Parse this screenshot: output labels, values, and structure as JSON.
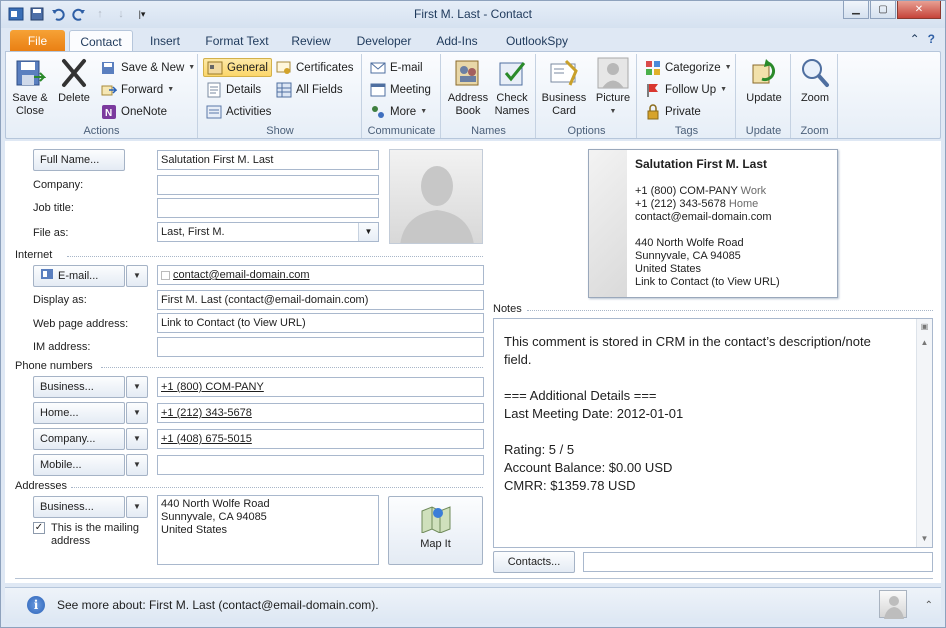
{
  "window": {
    "title": "First M. Last  -  Contact"
  },
  "qat": {
    "icons": [
      "outlook-icon",
      "save-icon",
      "undo-icon",
      "redo-icon",
      "prev-icon",
      "next-icon",
      "customize-icon"
    ]
  },
  "tabs": [
    "File",
    "Contact",
    "Insert",
    "Format Text",
    "Review",
    "Developer",
    "Add-Ins",
    "OutlookSpy"
  ],
  "ribbon": {
    "actions": {
      "save_close": "Save &\nClose",
      "delete": "Delete",
      "save_new": "Save & New",
      "forward": "Forward",
      "onenote": "OneNote",
      "label": "Actions"
    },
    "show": {
      "general": "General",
      "details": "Details",
      "activities": "Activities",
      "certificates": "Certificates",
      "all_fields": "All Fields",
      "label": "Show"
    },
    "communicate": {
      "email": "E-mail",
      "meeting": "Meeting",
      "more": "More",
      "label": "Communicate"
    },
    "names": {
      "address_book": "Address\nBook",
      "check_names": "Check\nNames",
      "label": "Names"
    },
    "options": {
      "business_card": "Business\nCard",
      "picture": "Picture",
      "label": "Options"
    },
    "tags": {
      "categorize": "Categorize",
      "follow_up": "Follow Up",
      "private": "Private",
      "label": "Tags"
    },
    "update": {
      "update": "Update",
      "label": "Update"
    },
    "zoom": {
      "zoom": "Zoom",
      "label": "Zoom"
    }
  },
  "form": {
    "full_name_btn": "Full Name...",
    "full_name": "Salutation First M. Last",
    "company_label": "Company:",
    "company": "",
    "job_title_label": "Job title:",
    "job_title": "",
    "file_as_label": "File as:",
    "file_as": "Last, First M.",
    "internet_section": "Internet",
    "email_btn": "E-mail...",
    "email": "contact@email-domain.com",
    "display_as_label": "Display as:",
    "display_as": "First M. Last (contact@email-domain.com)",
    "web_label": "Web page address:",
    "web": "Link to Contact (to View URL)",
    "im_label": "IM address:",
    "im": "",
    "phone_section": "Phone numbers",
    "phones": [
      {
        "label": "Business...",
        "value": "+1 (800) COM-PANY"
      },
      {
        "label": "Home...",
        "value": "+1 (212) 343-5678"
      },
      {
        "label": "Company...",
        "value": "+1 (408) 675-5015"
      },
      {
        "label": "Mobile...",
        "value": ""
      }
    ],
    "addresses_section": "Addresses",
    "address_btn": "Business...",
    "address_lines": "440 North Wolfe Road\nSunnyvale, CA 94085\nUnited States",
    "mailing_checkbox": "This is the mailing\naddress",
    "mailing_checked": true,
    "map_it": "Map It"
  },
  "business_card": {
    "name": "Salutation First M. Last",
    "phone1": "+1 (800) COM-PANY",
    "phone1_type": "Work",
    "phone2": "+1 (212) 343-5678",
    "phone2_type": "Home",
    "email": "contact@email-domain.com",
    "address1": "440 North Wolfe Road",
    "address2": "Sunnyvale, CA 94085",
    "address3": "United States",
    "web": "Link to Contact (to View URL)"
  },
  "notes": {
    "label": "Notes",
    "text": "This comment is stored in CRM in the contact’s description/note\nfield.\n\n=== Additional Details ===\nLast Meeting Date: 2012-01-01\n\nRating: 5 / 5\nAccount Balance: $0.00 USD\nCMRR: $1359.78 USD"
  },
  "contacts_btn": "Contacts...",
  "contacts_value": "",
  "status": {
    "text": "See more about: First M. Last (contact@email-domain.com)."
  }
}
